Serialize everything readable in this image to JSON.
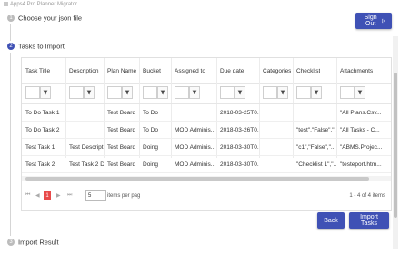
{
  "window": {
    "title": "Apps4.Pro Planner Migrator"
  },
  "steps": [
    {
      "num": "1",
      "label": "Choose your json file"
    },
    {
      "num": "2",
      "label": "Tasks to Import"
    },
    {
      "num": "3",
      "label": "Import Result"
    }
  ],
  "header": {
    "signout_label": "Sign Out"
  },
  "grid": {
    "columns": [
      "Task Title",
      "Description",
      "Plan Name",
      "Bucket",
      "Assigned to",
      "Due date",
      "Categories",
      "Checklist",
      "Attachments"
    ],
    "rows": [
      [
        "To Do Task 1",
        "",
        "Test Board",
        "To Do",
        "",
        "2018-03-25T0...",
        "",
        "",
        "\"All Plans.Csv..."
      ],
      [
        "To Do Task 2",
        "",
        "Test Board",
        "To Do",
        "MOD Adminis...",
        "2018-03-26T0...",
        "",
        "\"test\",\"False\",\"...",
        "\"All Tasks - C..."
      ],
      [
        "Test Task 1",
        "Test Descripti...",
        "Test Board",
        "Doing",
        "MOD Adminis...",
        "2018-03-30T0...",
        "",
        "\"c1\",\"False\",\"...",
        "\"ABMS.Projec..."
      ],
      [
        "Test Task 2",
        "Test Task 2 D...",
        "Test Board",
        "Doing",
        "MOD Adminis...",
        "2018-03-30T0...",
        "",
        "\"Checklist 1\",\"...",
        "\"testeport.htm..."
      ]
    ]
  },
  "pager": {
    "first": "⏮",
    "prev": "◀",
    "current": "1",
    "next": "▶",
    "last": "⏭",
    "page_size": "5",
    "page_size_label": "items per pag",
    "info": "1 - 4 of 4 items"
  },
  "actions": {
    "back_label": "Back",
    "import_label": "Import Tasks"
  },
  "colors": {
    "accent": "#3f51b5",
    "pager_active": "#e84a4a"
  }
}
